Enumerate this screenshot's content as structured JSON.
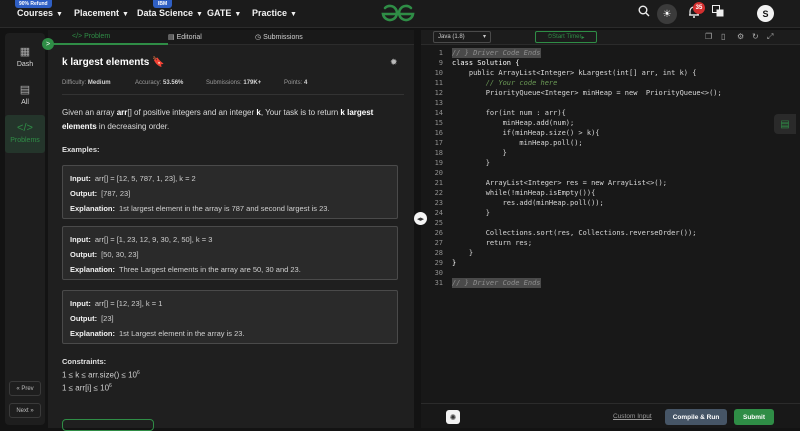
{
  "topbar": {
    "refund_badge": "90% Refund",
    "ibm_badge": "IBM",
    "nav": [
      "Courses",
      "Placement",
      "Data Science",
      "GATE",
      "Practice"
    ],
    "notification_count": "35",
    "avatar_initial": "S"
  },
  "sidebar": {
    "items": [
      "Dash",
      "All",
      "Problems"
    ],
    "prev": "« Prev",
    "next": "Next »"
  },
  "tabs": {
    "problem": "Problem",
    "editorial": "Editorial",
    "submissions": "Submissions"
  },
  "problem": {
    "title": "k largest elements",
    "difficulty_label": "Difficulty:",
    "difficulty": "Medium",
    "accuracy_label": "Accuracy:",
    "accuracy": "53.56%",
    "submissions_label": "Submissions:",
    "submissions": "179K+",
    "points_label": "Points:",
    "points": "4",
    "desc_1": "Given an array ",
    "desc_arr": "arr",
    "desc_2": "[] of positive integers and an integer ",
    "desc_k": "k",
    "desc_3": ", Your task is to return ",
    "desc_bold": "k largest elements",
    "desc_4": " in decreasing order.",
    "examples_title": "Examples:",
    "input_label": "Input:",
    "output_label": "Output:",
    "explanation_label": "Explanation:",
    "examples": [
      {
        "input": "arr[] = [12, 5, 787, 1, 23], k = 2",
        "output": "[787, 23]",
        "explanation": "1st largest element in the array is 787 and second largest is 23."
      },
      {
        "input": "arr[] = [1, 23, 12, 9, 30, 2, 50], k = 3",
        "output": "[50, 30, 23]",
        "explanation": "Three Largest elements in the array are 50, 30 and 23."
      },
      {
        "input": "arr[] = [12, 23], k = 1",
        "output": "[23]",
        "explanation": "1st Largest element in the array is 23."
      }
    ],
    "constraints_title": "Constraints:",
    "constraint_1": "1 ≤ k ≤ arr.size() ≤ 10",
    "constraint_1_exp": "6",
    "constraint_2": "1 ≤ arr[i] ≤ 10",
    "constraint_2_exp": "6"
  },
  "editor": {
    "language": "Java (1.8)",
    "timer": "Start Timer",
    "custom_input": "Custom Input",
    "compile": "Compile & Run",
    "submit": "Submit",
    "lines": [
      {
        "n": "1",
        "t": "// } Driver Code Ends"
      },
      {
        "n": "9",
        "t": "class Solution {"
      },
      {
        "n": "10",
        "t": "    public ArrayList<Integer> kLargest(int[] arr, int k) {"
      },
      {
        "n": "11",
        "t": "        // Your code here"
      },
      {
        "n": "12",
        "t": "        PriorityQueue<Integer> minHeap = new  PriorityQueue<>();"
      },
      {
        "n": "13",
        "t": ""
      },
      {
        "n": "14",
        "t": "        for(int num : arr){"
      },
      {
        "n": "15",
        "t": "            minHeap.add(num);"
      },
      {
        "n": "16",
        "t": "            if(minHeap.size() > k){"
      },
      {
        "n": "17",
        "t": "                minHeap.poll();"
      },
      {
        "n": "18",
        "t": "            }"
      },
      {
        "n": "19",
        "t": "        }"
      },
      {
        "n": "20",
        "t": ""
      },
      {
        "n": "21",
        "t": "        ArrayList<Integer> res = new ArrayList<>();"
      },
      {
        "n": "22",
        "t": "        while(!minHeap.isEmpty()){"
      },
      {
        "n": "23",
        "t": "            res.add(minHeap.poll());"
      },
      {
        "n": "24",
        "t": "        }"
      },
      {
        "n": "25",
        "t": ""
      },
      {
        "n": "26",
        "t": "        Collections.sort(res, Collections.reverseOrder());"
      },
      {
        "n": "27",
        "t": "        return res;"
      },
      {
        "n": "28",
        "t": "    }"
      },
      {
        "n": "29",
        "t": "}"
      },
      {
        "n": "30",
        "t": ""
      },
      {
        "n": "31",
        "t": "// } Driver Code Ends"
      }
    ]
  },
  "colors": {
    "accent": "#2f8d46",
    "background": "#131313",
    "panel": "#1f1f1f",
    "editor": "#181818"
  }
}
